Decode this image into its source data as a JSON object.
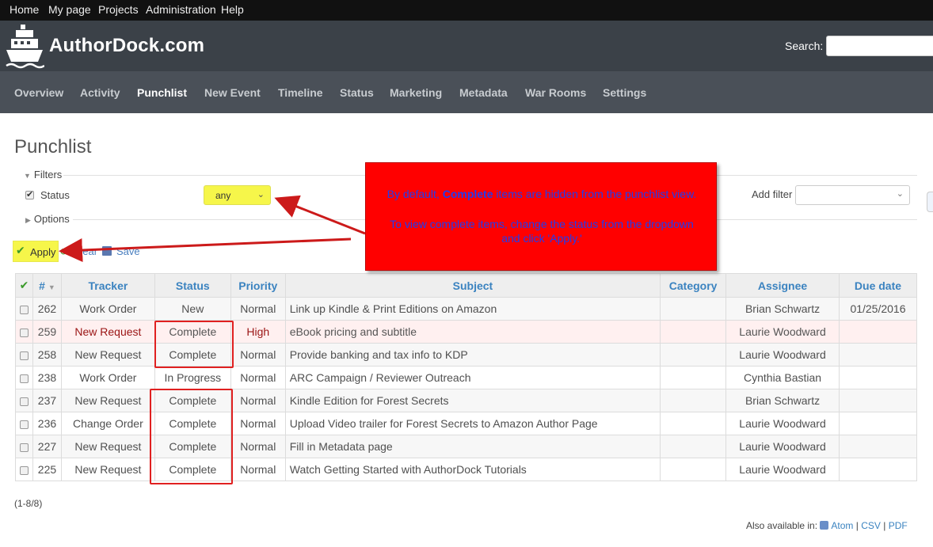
{
  "topmenu": [
    "Home",
    "My page",
    "Projects",
    "Administration",
    "Help"
  ],
  "header": {
    "site_title": "AuthorDock.com",
    "search_label": "Search:"
  },
  "mainnav": [
    "Overview",
    "Activity",
    "Punchlist",
    "New Event",
    "Timeline",
    "Status",
    "Marketing",
    "Metadata",
    "War Rooms",
    "Settings"
  ],
  "page": {
    "title": "Punchlist"
  },
  "filters": {
    "legend": "Filters",
    "status_label": "Status",
    "status_value": "any",
    "add_filter_label": "Add filter",
    "options_legend": "Options"
  },
  "actions": {
    "apply": "Apply",
    "clear": "Clear",
    "save": "Save"
  },
  "callout": {
    "line1_pre": "By default,",
    "line1_bold": "Complete",
    "line1_post": "items are hidden from the punchlist view.",
    "line2": "To view complete items, change the status from the dropdown",
    "line3": "and click 'Apply.'"
  },
  "table": {
    "columns": [
      "#",
      "Tracker",
      "Status",
      "Priority",
      "Subject",
      "Category",
      "Assignee",
      "Due date"
    ],
    "rows": [
      {
        "id": "262",
        "tracker": "Work Order",
        "status": "New",
        "priority": "Normal",
        "subject": "Link up Kindle & Print Editions on Amazon",
        "category": "",
        "assignee": "Brian Schwartz",
        "due": "01/25/2016"
      },
      {
        "id": "259",
        "tracker": "New Request",
        "status": "Complete",
        "priority": "High",
        "subject": "eBook pricing and subtitle",
        "category": "",
        "assignee": "Laurie Woodward",
        "due": ""
      },
      {
        "id": "258",
        "tracker": "New Request",
        "status": "Complete",
        "priority": "Normal",
        "subject": "Provide banking and tax info to KDP",
        "category": "",
        "assignee": "Laurie Woodward",
        "due": ""
      },
      {
        "id": "238",
        "tracker": "Work Order",
        "status": "In Progress",
        "priority": "Normal",
        "subject": "ARC Campaign / Reviewer Outreach",
        "category": "",
        "assignee": "Cynthia Bastian",
        "due": ""
      },
      {
        "id": "237",
        "tracker": "New Request",
        "status": "Complete",
        "priority": "Normal",
        "subject": "Kindle Edition for Forest Secrets",
        "category": "",
        "assignee": "Brian Schwartz",
        "due": ""
      },
      {
        "id": "236",
        "tracker": "Change Order",
        "status": "Complete",
        "priority": "Normal",
        "subject": "Upload Video trailer for Forest Secrets to Amazon Author Page",
        "category": "",
        "assignee": "Laurie Woodward",
        "due": ""
      },
      {
        "id": "227",
        "tracker": "New Request",
        "status": "Complete",
        "priority": "Normal",
        "subject": "Fill in Metadata page",
        "category": "",
        "assignee": "Laurie Woodward",
        "due": ""
      },
      {
        "id": "225",
        "tracker": "New Request",
        "status": "Complete",
        "priority": "Normal",
        "subject": "Watch Getting Started with AuthorDock Tutorials",
        "category": "",
        "assignee": "Laurie Woodward",
        "due": ""
      }
    ]
  },
  "footer": {
    "count": "(1-8/8)",
    "also_available": "Also available in:",
    "formats": [
      "Atom",
      "CSV",
      "PDF"
    ]
  },
  "colors": {
    "accent": "#3b83c0",
    "highlight_yellow": "#f6f64a",
    "callout_red": "#ff0000",
    "callout_text": "#1f3df0"
  }
}
